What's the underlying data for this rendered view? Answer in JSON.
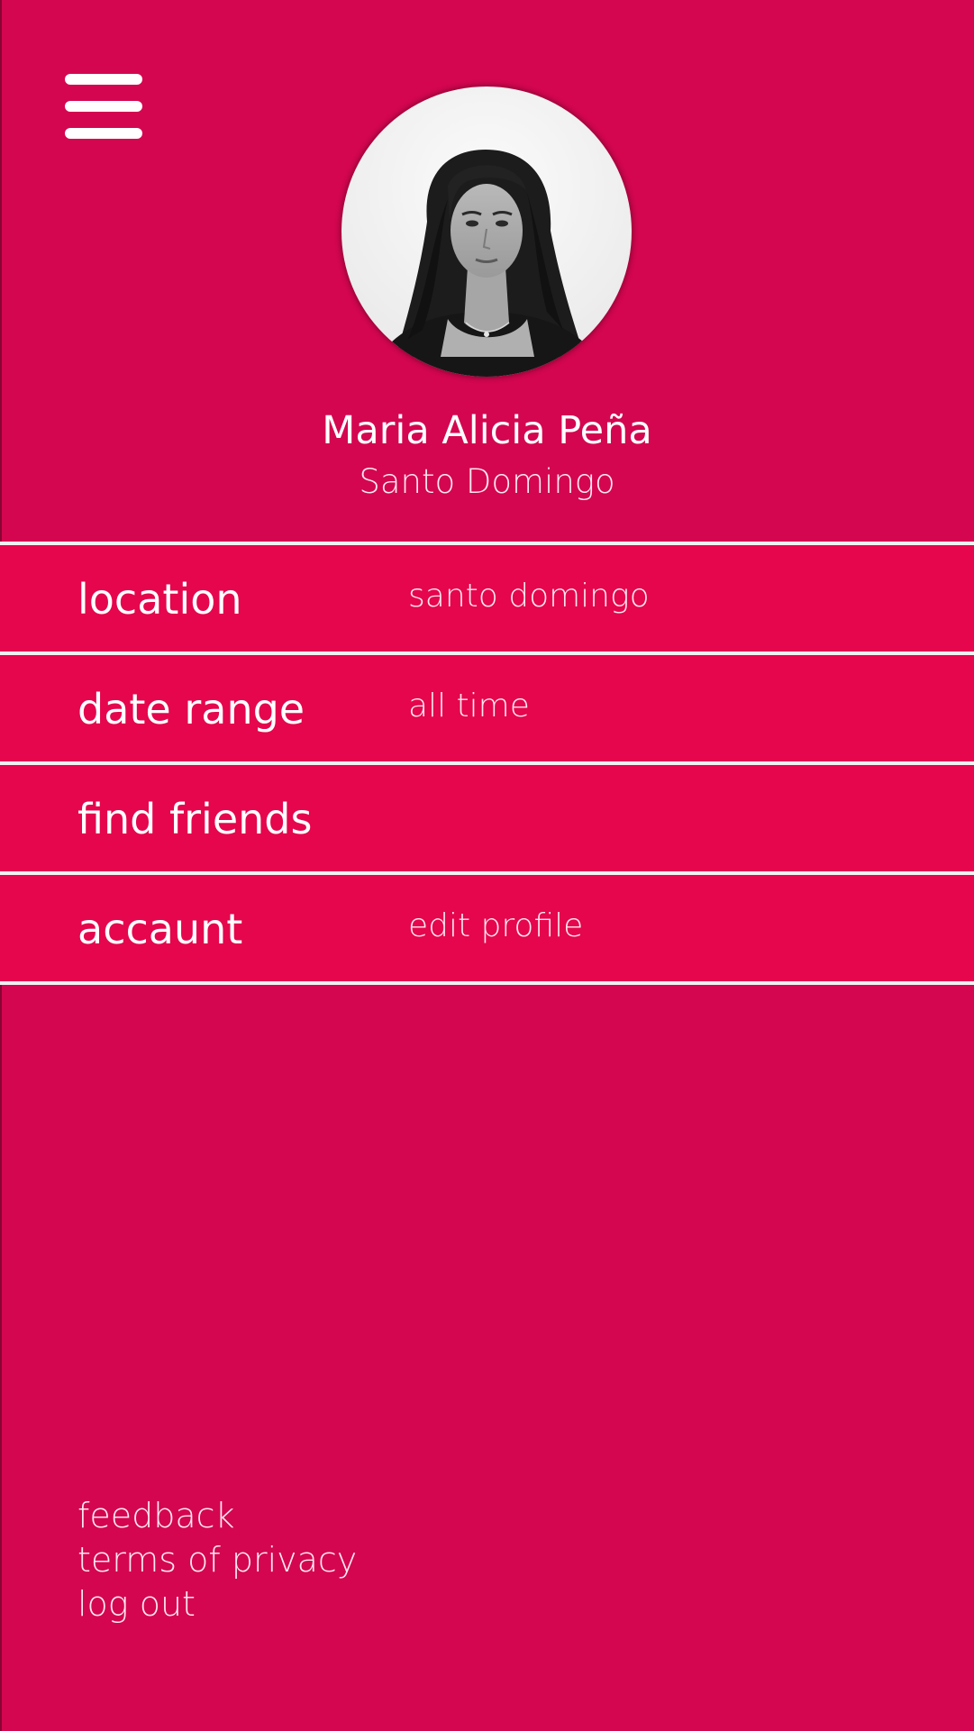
{
  "profile": {
    "name": "Maria Alicia Peña",
    "city": "Santo Domingo"
  },
  "menu": {
    "icon": "hamburger-menu-icon",
    "items": [
      {
        "label": "location",
        "value": "santo domingo"
      },
      {
        "label": "date range",
        "value": "all time"
      },
      {
        "label": "find friends",
        "value": ""
      },
      {
        "label": "accaunt",
        "value": "edit profile"
      }
    ]
  },
  "footer": {
    "links": [
      "feedback",
      "terms of privacy",
      "log out"
    ]
  },
  "colors": {
    "background": "#d40650",
    "row_background": "#e5064d",
    "divider": "#f2f2f2",
    "text": "#ffffff"
  }
}
